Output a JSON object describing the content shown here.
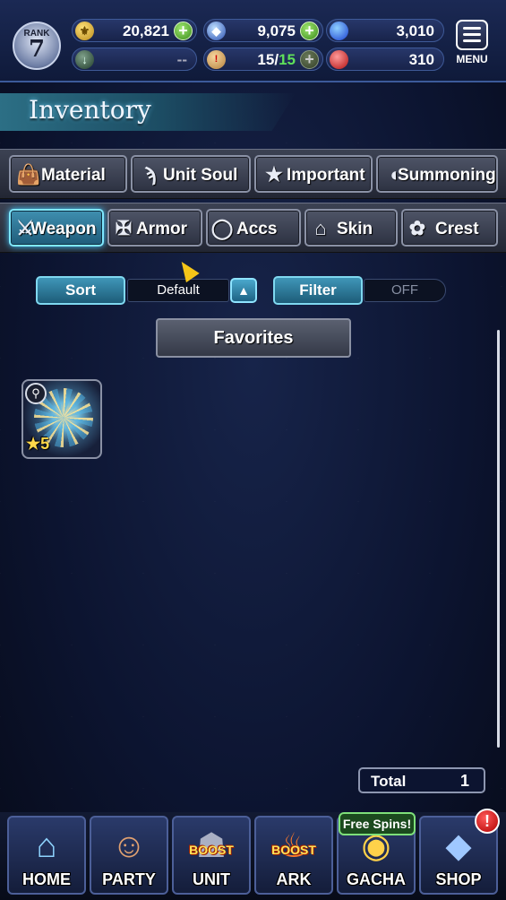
{
  "status": {
    "rank_label": "RANK",
    "rank_value": "7",
    "gil": "20,821",
    "lapis": "9,075",
    "blue_orbs": "3,010",
    "slot_value": "--",
    "stamina_current": "15",
    "stamina_separator": "/",
    "stamina_max": "15",
    "red_orbs": "310",
    "menu_label": "MENU"
  },
  "page": {
    "title": "Inventory"
  },
  "category_tabs": [
    {
      "label": "Material",
      "icon": "bag-icon"
    },
    {
      "label": "Unit Soul",
      "icon": "flame-icon"
    },
    {
      "label": "Important",
      "icon": "star-icon"
    },
    {
      "label": "Summoning",
      "icon": "summon-icon"
    }
  ],
  "equip_tabs": [
    {
      "label": "Weapon",
      "icon": "sword-icon",
      "active": true
    },
    {
      "label": "Armor",
      "icon": "armor-icon",
      "active": false
    },
    {
      "label": "Accs",
      "icon": "ring-icon",
      "active": false
    },
    {
      "label": "Skin",
      "icon": "hanger-icon",
      "active": false
    },
    {
      "label": "Crest",
      "icon": "crest-icon",
      "active": false
    }
  ],
  "controls": {
    "sort_label": "Sort",
    "sort_value": "Default",
    "filter_label": "Filter",
    "filter_value": "OFF",
    "favorites_label": "Favorites"
  },
  "items": [
    {
      "rarity": "5",
      "type_icon": "key-icon"
    }
  ],
  "total": {
    "label": "Total",
    "value": "1"
  },
  "bottom_nav": [
    {
      "label": "HOME"
    },
    {
      "label": "PARTY"
    },
    {
      "label": "UNIT",
      "tag": "BOOST"
    },
    {
      "label": "ARK",
      "tag": "BOOST"
    },
    {
      "label": "GACHA",
      "banner": "Free Spins!"
    },
    {
      "label": "SHOP",
      "badge": "!"
    }
  ]
}
